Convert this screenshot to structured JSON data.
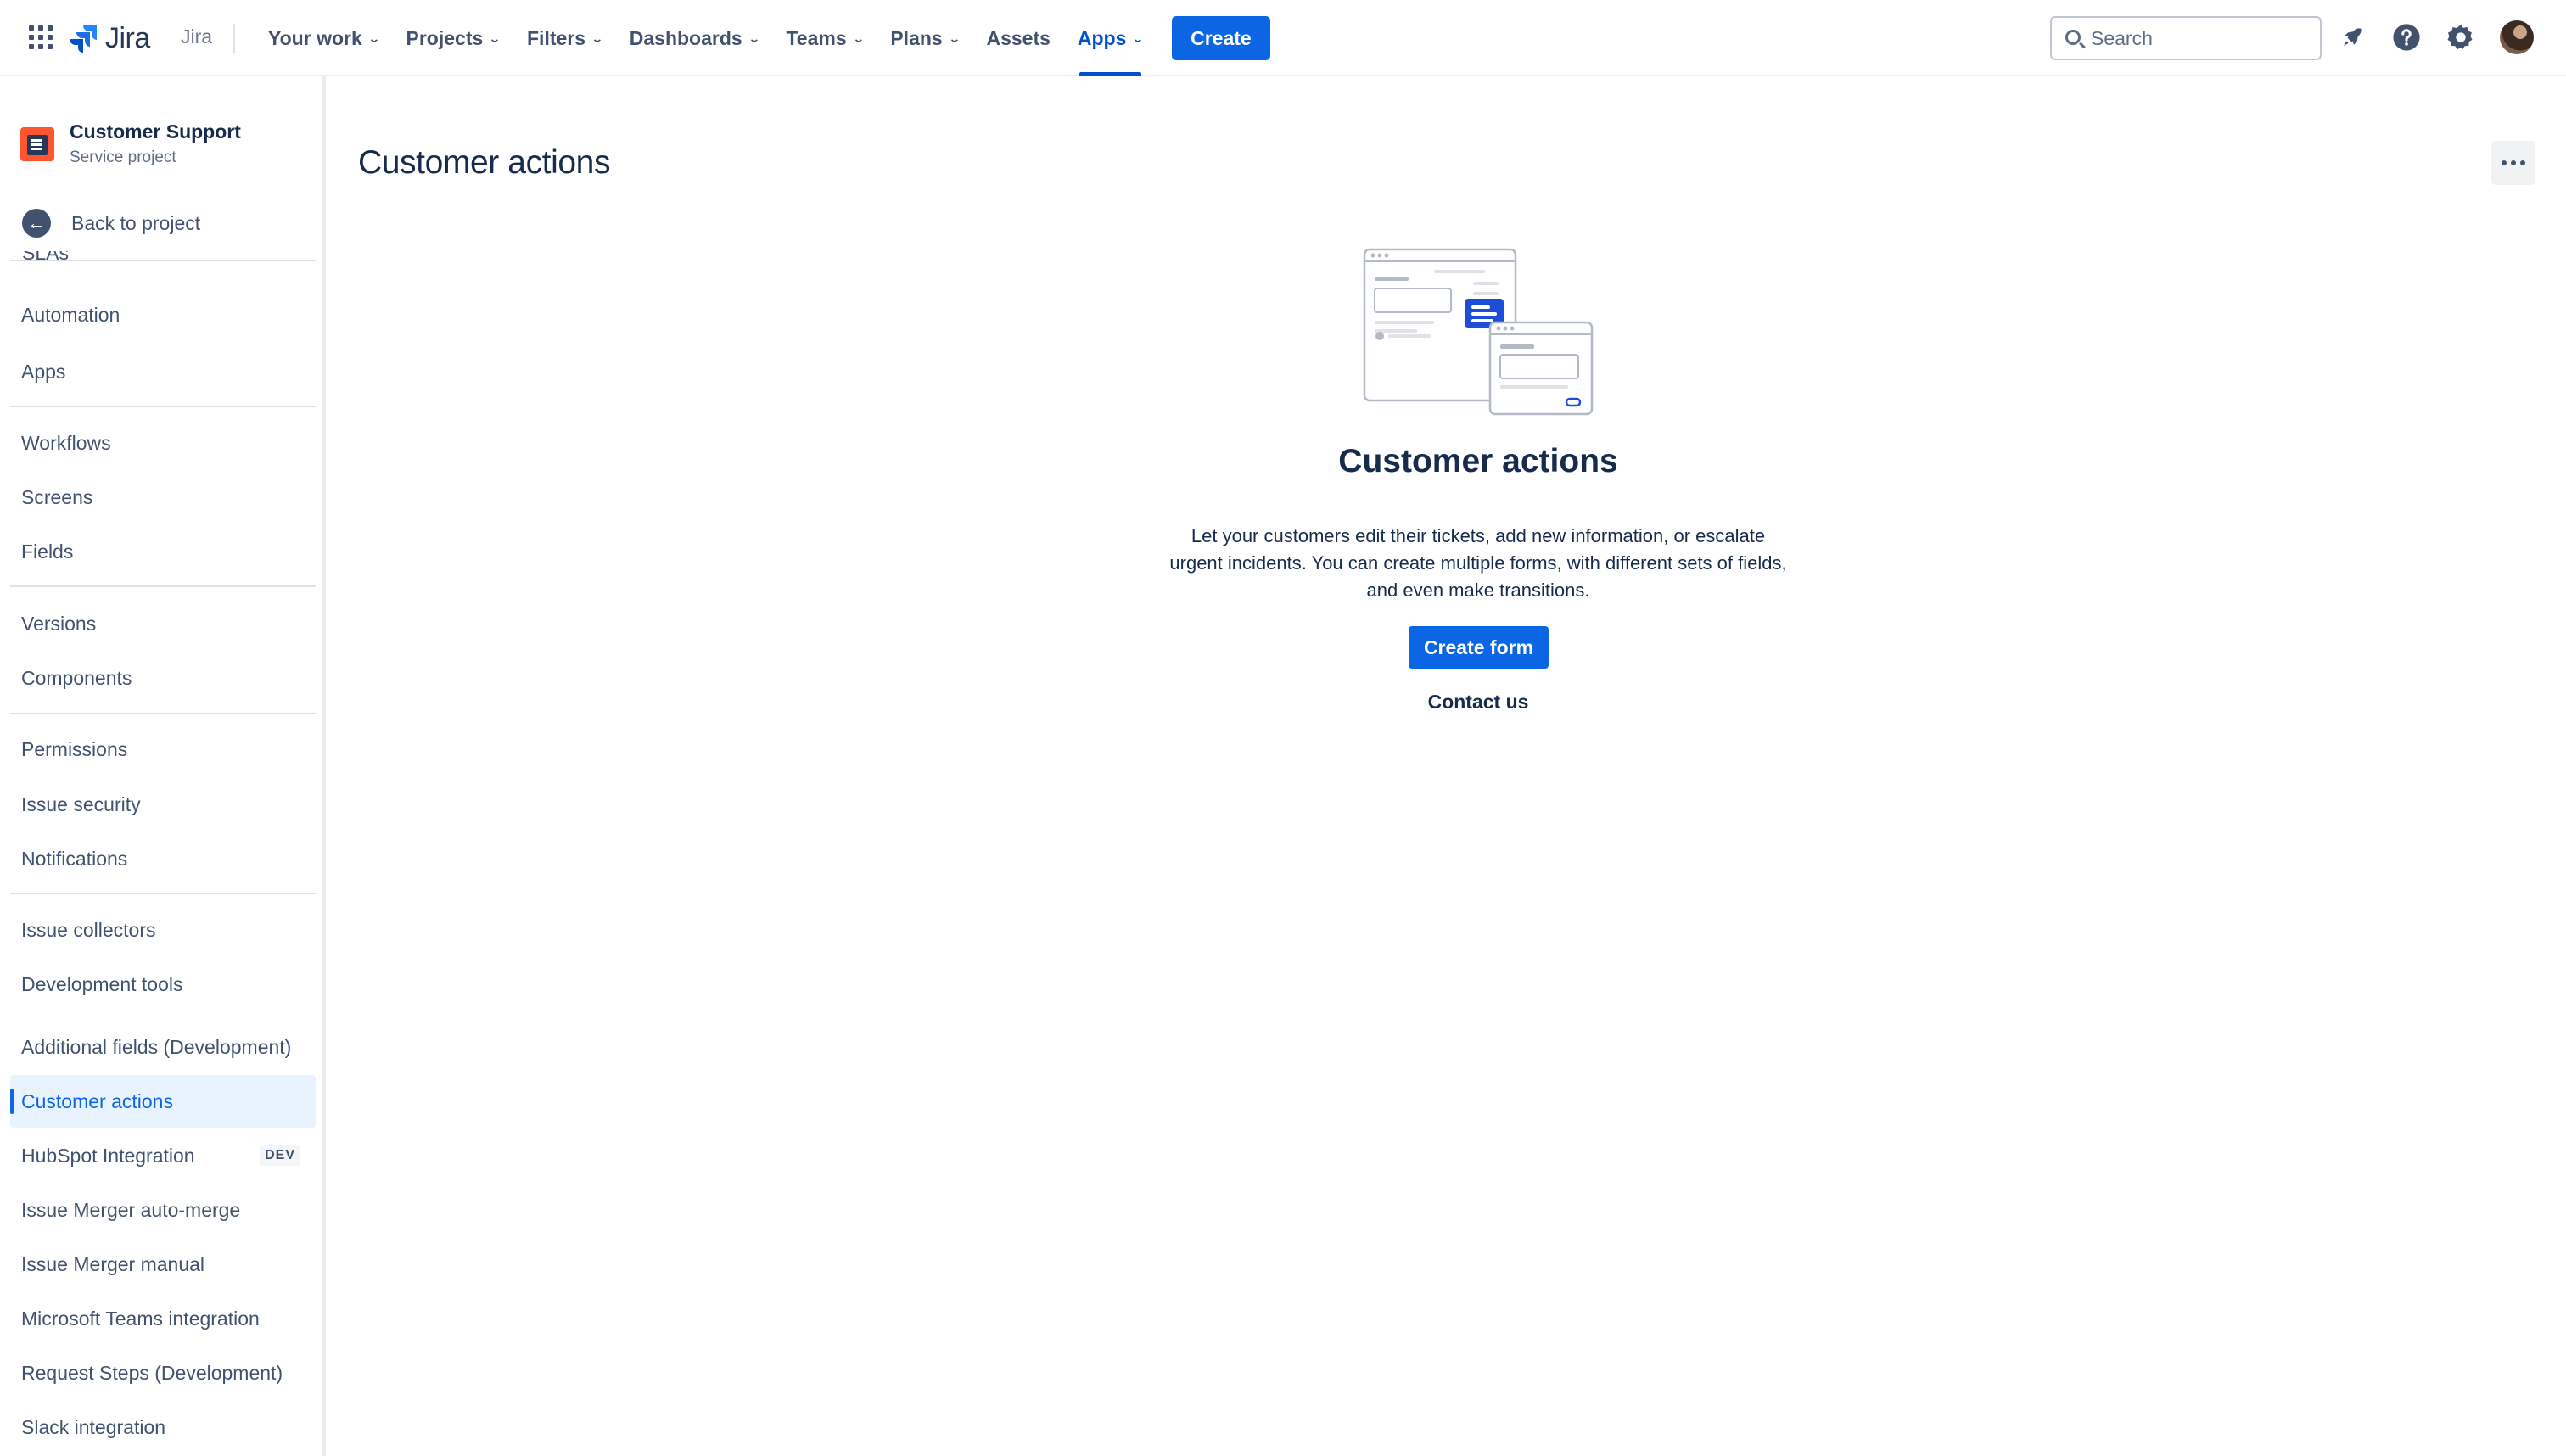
{
  "topbar": {
    "logo_text": "Jira",
    "product_label": "Jira",
    "nav": [
      {
        "label": "Your work",
        "chevron": true
      },
      {
        "label": "Projects",
        "chevron": true
      },
      {
        "label": "Filters",
        "chevron": true
      },
      {
        "label": "Dashboards",
        "chevron": true
      },
      {
        "label": "Teams",
        "chevron": true
      },
      {
        "label": "Plans",
        "chevron": true
      },
      {
        "label": "Assets",
        "chevron": false
      },
      {
        "label": "Apps",
        "chevron": true,
        "active": true
      }
    ],
    "create_label": "Create",
    "search_placeholder": "Search",
    "icons": [
      "app-switcher-icon",
      "notifications-icon",
      "help-icon",
      "settings-icon",
      "avatar"
    ]
  },
  "sidebar": {
    "project_name": "Customer Support",
    "project_type": "Service project",
    "back_label": "Back to project",
    "cut_item": "SLAs",
    "items": [
      {
        "label": "Automation"
      },
      {
        "label": "Apps"
      },
      {
        "label": "Workflows"
      },
      {
        "label": "Screens"
      },
      {
        "label": "Fields"
      },
      {
        "label": "Versions"
      },
      {
        "label": "Components"
      },
      {
        "label": "Permissions"
      },
      {
        "label": "Issue security"
      },
      {
        "label": "Notifications"
      },
      {
        "label": "Issue collectors"
      },
      {
        "label": "Development tools"
      },
      {
        "label": "Additional fields (Development)"
      },
      {
        "label": "Customer actions",
        "active": true
      },
      {
        "label": "HubSpot Integration",
        "badge": "DEV"
      },
      {
        "label": "Issue Merger auto-merge"
      },
      {
        "label": "Issue Merger manual"
      },
      {
        "label": "Microsoft Teams integration"
      },
      {
        "label": "Request Steps (Development)"
      },
      {
        "label": "Slack integration"
      }
    ]
  },
  "main": {
    "title": "Customer actions",
    "empty_state": {
      "heading": "Customer actions",
      "description": "Let your customers edit their tickets, add new information, or escalate urgent incidents. You can create multiple forms, with different sets of fields, and even make transitions.",
      "primary_button": "Create form",
      "secondary_link": "Contact us"
    }
  },
  "colors": {
    "brand_blue": "#0c66e4",
    "nav_active": "#0052cc",
    "text_primary": "#172b4d",
    "text_secondary": "#42526e",
    "active_bg": "#e9f2ff",
    "project_icon": "#ff5630"
  }
}
